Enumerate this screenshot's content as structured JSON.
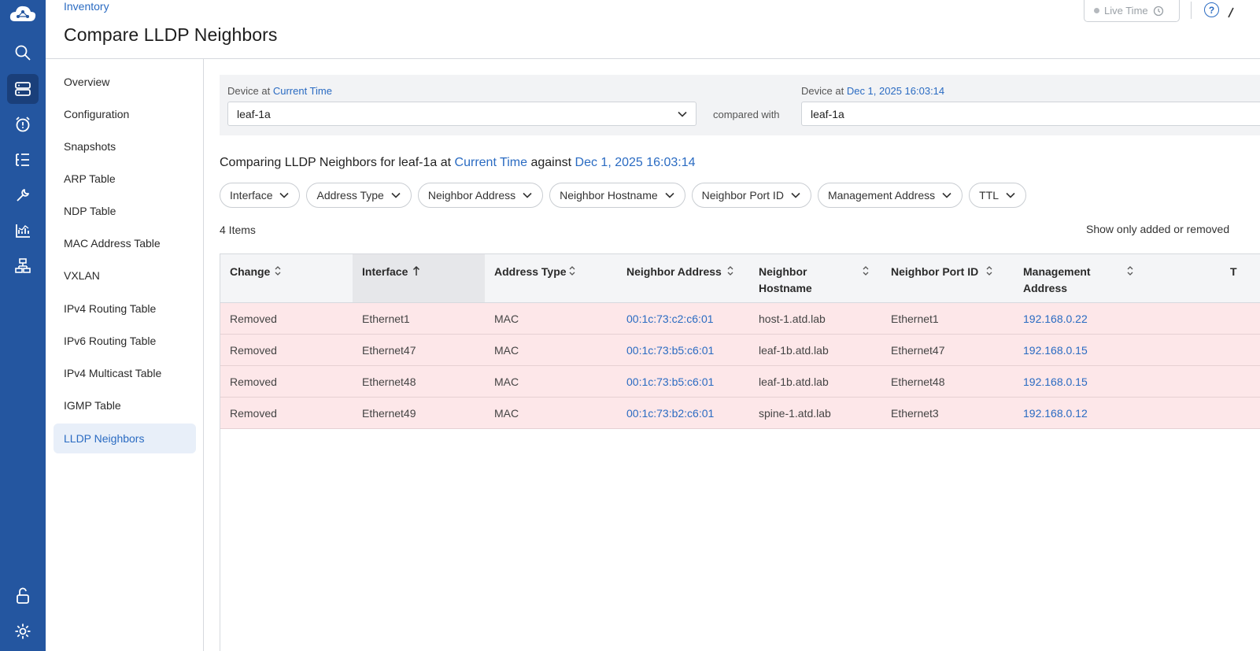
{
  "breadcrumb": "Inventory",
  "page_title": "Compare LLDP Neighbors",
  "live_time_label": "Live Time",
  "help_label": "?",
  "rail_icons": [
    "cloudvision-logo",
    "search-icon",
    "devices-icon",
    "alarm-icon",
    "events-list-icon",
    "wrench-icon",
    "dashboard-chart-icon",
    "topology-icon",
    "unlock-icon",
    "settings-gear-icon"
  ],
  "sidebar": {
    "items": [
      {
        "label": "Overview"
      },
      {
        "label": "Configuration"
      },
      {
        "label": "Snapshots"
      },
      {
        "label": "ARP Table"
      },
      {
        "label": "NDP Table"
      },
      {
        "label": "MAC Address Table"
      },
      {
        "label": "VXLAN"
      },
      {
        "label": "IPv4 Routing Table"
      },
      {
        "label": "IPv6 Routing Table"
      },
      {
        "label": "IPv4 Multicast Table"
      },
      {
        "label": "IGMP Table"
      },
      {
        "label": "LLDP Neighbors"
      }
    ],
    "active": "LLDP Neighbors"
  },
  "device_left": {
    "prefix": "Device at",
    "time": "Current Time",
    "value": "leaf-1a"
  },
  "compared_with": "compared with",
  "device_right": {
    "prefix": "Device at",
    "time": "Dec 1, 2025 16:03:14",
    "value": "leaf-1a"
  },
  "comparison": {
    "prefix": "Comparing LLDP Neighbors for leaf-1a at",
    "left_time": "Current Time",
    "middle": "against",
    "right_time": "Dec 1, 2025 16:03:14"
  },
  "filters": [
    "Interface",
    "Address Type",
    "Neighbor Address",
    "Neighbor Hostname",
    "Neighbor Port ID",
    "Management Address",
    "TTL"
  ],
  "items_count": "4 Items",
  "show_only": "Show only added or removed",
  "table": {
    "columns": [
      {
        "label": "Change",
        "label2": ""
      },
      {
        "label": "Interface",
        "label2": ""
      },
      {
        "label": "Address Type",
        "label2": ""
      },
      {
        "label": "Neighbor Address",
        "label2": ""
      },
      {
        "label": "Neighbor",
        "label2": "Hostname"
      },
      {
        "label": "Neighbor Port ID",
        "label2": ""
      },
      {
        "label": "Management",
        "label2": "Address"
      },
      {
        "label": "T",
        "label2": ""
      }
    ],
    "sorted_column": "Interface",
    "sort_direction": "ascending",
    "rows": [
      {
        "change": "Removed",
        "interface": "Ethernet1",
        "address_type": "MAC",
        "neighbor_address": "00:1c:73:c2:c6:01",
        "hostname": "host-1.atd.lab",
        "port_id": "Ethernet1",
        "mgmt": "192.168.0.22"
      },
      {
        "change": "Removed",
        "interface": "Ethernet47",
        "address_type": "MAC",
        "neighbor_address": "00:1c:73:b5:c6:01",
        "hostname": "leaf-1b.atd.lab",
        "port_id": "Ethernet47",
        "mgmt": "192.168.0.15"
      },
      {
        "change": "Removed",
        "interface": "Ethernet48",
        "address_type": "MAC",
        "neighbor_address": "00:1c:73:b5:c6:01",
        "hostname": "leaf-1b.atd.lab",
        "port_id": "Ethernet48",
        "mgmt": "192.168.0.15"
      },
      {
        "change": "Removed",
        "interface": "Ethernet49",
        "address_type": "MAC",
        "neighbor_address": "00:1c:73:b2:c6:01",
        "hostname": "spine-1.atd.lab",
        "port_id": "Ethernet3",
        "mgmt": "192.168.0.12"
      }
    ]
  },
  "colors": {
    "rail": "#2456a0",
    "link": "#2a6bc2",
    "removed_row": "#fde7e9"
  }
}
